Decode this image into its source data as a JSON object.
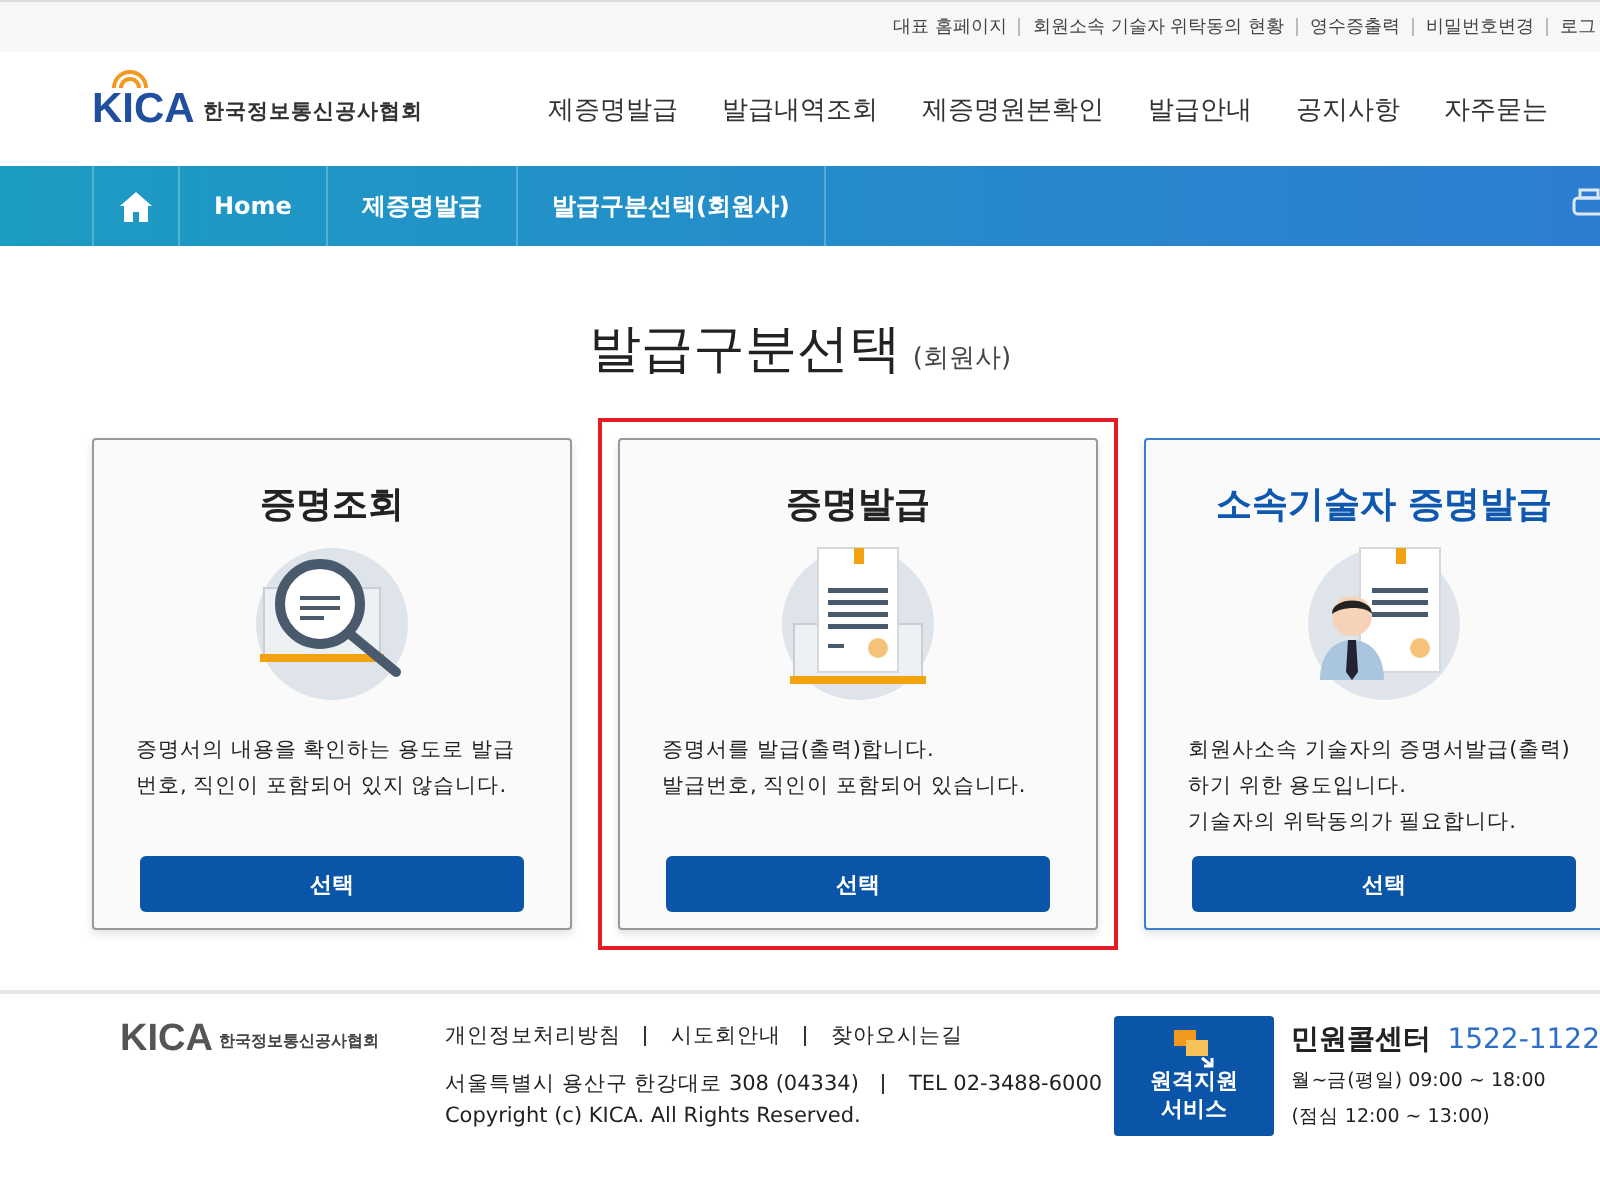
{
  "top_links": [
    "대표 홈페이지",
    "회원소속 기술자 위탁동의 현황",
    "영수증출력",
    "비밀번호변경",
    "로그"
  ],
  "logo": {
    "mark": "KICA",
    "name": "한국정보통신공사협회"
  },
  "nav": [
    "제증명발급",
    "발급내역조회",
    "제증명원본확인",
    "발급안내",
    "공지사항",
    "자주묻는"
  ],
  "breadcrumb": [
    "Home",
    "제증명발급",
    "발급구분선택(회원사)"
  ],
  "page_title": {
    "main": "발급구분선택",
    "sub": "(회원사)"
  },
  "cards": [
    {
      "kind": "search",
      "title": "증명조회",
      "description": "증명서의 내용을 확인하는 용도로 발급번호, 직인이 포함되어 있지 않습니다.",
      "button": "선택",
      "selected": false,
      "highlighted": false
    },
    {
      "kind": "issue",
      "title": "증명발급",
      "description": "증명서를 발급(출력)합니다.\n발급번호, 직인이 포함되어 있습니다.",
      "button": "선택",
      "selected": false,
      "highlighted": true
    },
    {
      "kind": "member",
      "title": "소속기술자 증명발급",
      "description": "회원사소속 기술자의 증명서발급(출력)하기 위한 용도입니다.\n기술자의 위탁동의가 필요합니다.",
      "button": "선택",
      "selected": true,
      "highlighted": false
    }
  ],
  "footer": {
    "logo_mark": "KICA",
    "logo_name": "한국정보통신공사협회",
    "links": [
      "개인정보처리방침",
      "시도회안내",
      "찾아오시는길"
    ],
    "address": "서울특별시 용산구 한강대로 308 (04334)",
    "tel": "TEL 02-3488-6000",
    "copyright": "Copyright (c) KICA. All Rights Reserved.",
    "remote_button": "원격지원\n서비스",
    "call_label": "민원콜센터",
    "call_number": "1522-1122",
    "hours": "월~금(평일) 09:00 ~ 18:00",
    "lunch": "(점심 12:00 ~ 13:00)"
  }
}
